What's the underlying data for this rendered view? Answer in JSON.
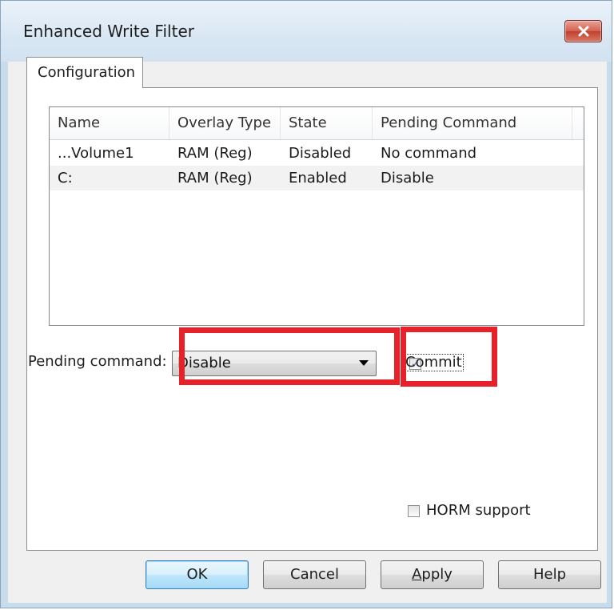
{
  "window": {
    "title": "Enhanced Write Filter"
  },
  "tabs": [
    {
      "label": "Configuration",
      "selected": true
    }
  ],
  "table": {
    "columns": [
      "Name",
      "Overlay Type",
      "State",
      "Pending Command"
    ],
    "rows": [
      [
        "...Volume1",
        "RAM (Reg)",
        "Disabled",
        "No command"
      ],
      [
        "C:",
        "RAM (Reg)",
        "Enabled",
        "Disable"
      ]
    ]
  },
  "pending": {
    "label": "Pending command:",
    "selected": "Disable"
  },
  "commit": {
    "label": "Commit",
    "checked": true
  },
  "horm": {
    "label": "HORM support",
    "checked": false
  },
  "buttons": {
    "ok": "OK",
    "cancel": "Cancel",
    "apply_first": "A",
    "apply_rest": "pply",
    "help": "Help"
  },
  "icons": {
    "close": "close-icon",
    "dropdown": "chevron-down-icon",
    "check": "checkmark-icon"
  },
  "colors": {
    "highlight": "#e8202a",
    "titlebar": "#d9e7f4",
    "close_button": "#c0412f",
    "default_button": "#bee6fd"
  }
}
